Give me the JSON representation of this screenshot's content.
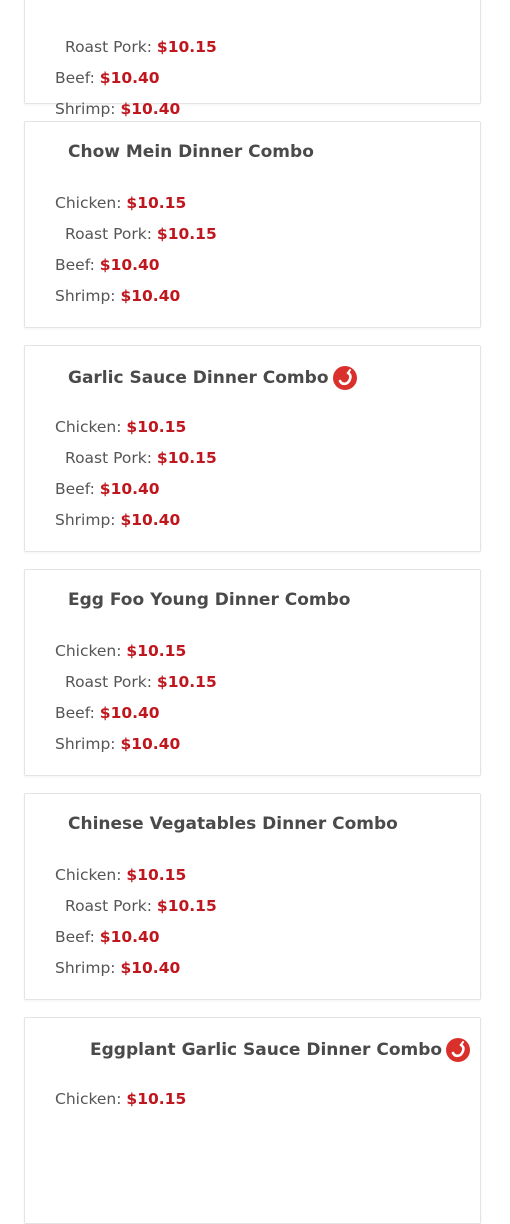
{
  "cards": [
    {
      "items": [
        {
          "label": "Roast Pork:",
          "price": "$10.15"
        },
        {
          "label": "Beef:",
          "price": "$10.40"
        },
        {
          "label": "Shrimp:",
          "price": "$10.40"
        }
      ]
    },
    {
      "title": "Chow Mein Dinner Combo",
      "spicy": false,
      "items": [
        {
          "label": "Chicken:",
          "price": "$10.15"
        },
        {
          "label": "Roast Pork:",
          "price": "$10.15"
        },
        {
          "label": "Beef:",
          "price": "$10.40"
        },
        {
          "label": "Shrimp:",
          "price": "$10.40"
        }
      ]
    },
    {
      "title": "Garlic Sauce Dinner Combo",
      "spicy": true,
      "items": [
        {
          "label": "Chicken:",
          "price": "$10.15"
        },
        {
          "label": "Roast Pork:",
          "price": "$10.15"
        },
        {
          "label": "Beef:",
          "price": "$10.40"
        },
        {
          "label": "Shrimp:",
          "price": "$10.40"
        }
      ]
    },
    {
      "title": "Egg Foo Young Dinner Combo",
      "spicy": false,
      "items": [
        {
          "label": "Chicken:",
          "price": "$10.15"
        },
        {
          "label": "Roast Pork:",
          "price": "$10.15"
        },
        {
          "label": "Beef:",
          "price": "$10.40"
        },
        {
          "label": "Shrimp:",
          "price": "$10.40"
        }
      ]
    },
    {
      "title": "Chinese Vegatables Dinner Combo",
      "spicy": false,
      "items": [
        {
          "label": "Chicken:",
          "price": "$10.15"
        },
        {
          "label": "Roast Pork:",
          "price": "$10.15"
        },
        {
          "label": "Beef:",
          "price": "$10.40"
        },
        {
          "label": "Shrimp:",
          "price": "$10.40"
        }
      ]
    },
    {
      "title": "Eggplant Garlic Sauce Dinner Combo",
      "spicy": true,
      "items": [
        {
          "label": "Chicken:",
          "price": "$10.15"
        }
      ]
    }
  ],
  "colors": {
    "price": "#c0161e",
    "spicy_icon": "#d9302c"
  },
  "icons": {
    "spicy": "chili-pepper-icon"
  }
}
